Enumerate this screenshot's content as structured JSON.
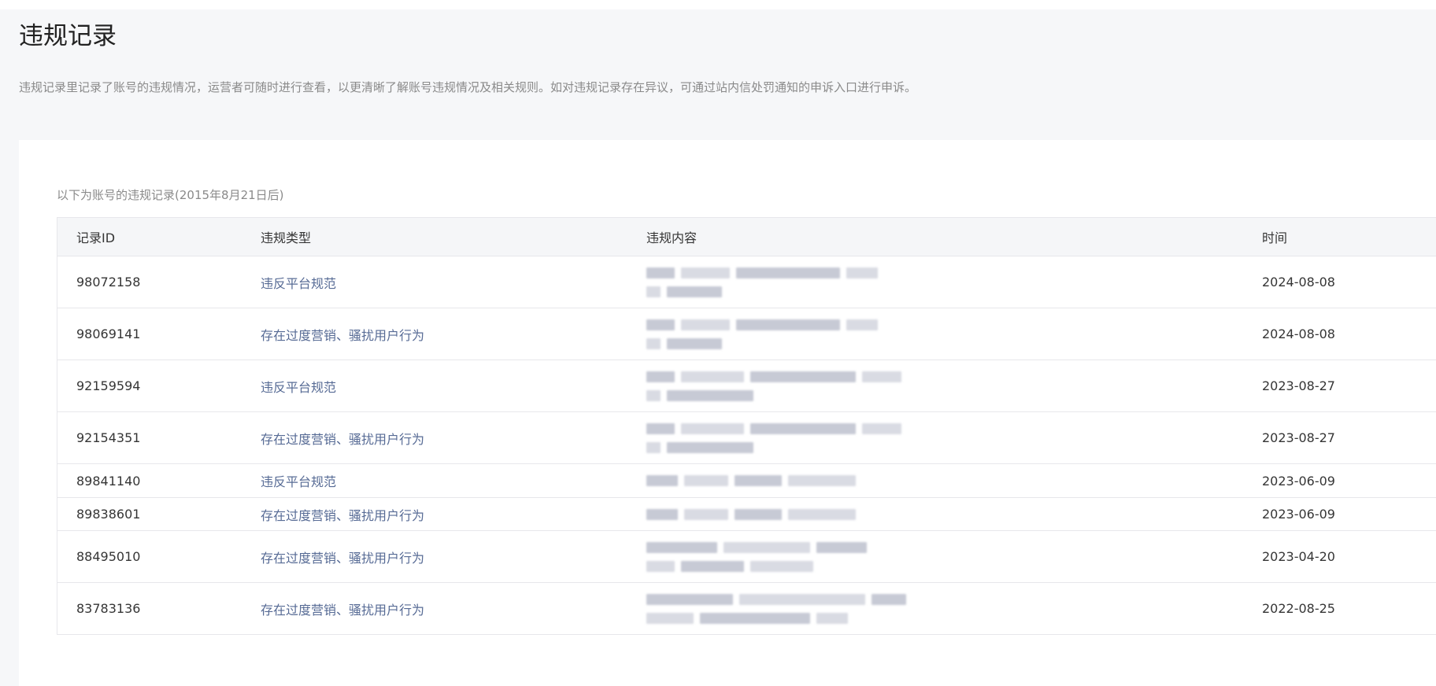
{
  "page": {
    "title": "违规记录",
    "description": "违规记录里记录了账号的违规情况，运营者可随时进行查看，以更清晰了解账号违规情况及相关规则。如对违规记录存在异议，可通过站内信处罚通知的申诉入口进行申诉。"
  },
  "card": {
    "note": "以下为账号的违规记录(2015年8月21日后)"
  },
  "table": {
    "columns": [
      "记录ID",
      "违规类型",
      "违规内容",
      "时间"
    ],
    "rows": [
      {
        "id": "98072158",
        "type": "违反平台规范",
        "date": "2024-08-08"
      },
      {
        "id": "98069141",
        "type": "存在过度营销、骚扰用户行为",
        "date": "2024-08-08"
      },
      {
        "id": "92159594",
        "type": "违反平台规范",
        "date": "2023-08-27"
      },
      {
        "id": "92154351",
        "type": "存在过度营销、骚扰用户行为",
        "date": "2023-08-27"
      },
      {
        "id": "89841140",
        "type": "违反平台规范",
        "date": "2023-06-09"
      },
      {
        "id": "89838601",
        "type": "存在过度营销、骚扰用户行为",
        "date": "2023-06-09"
      },
      {
        "id": "88495010",
        "type": "存在过度营销、骚扰用户行为",
        "date": "2023-04-20"
      },
      {
        "id": "83783136",
        "type": "存在过度营销、骚扰用户行为",
        "date": "2022-08-25"
      }
    ]
  },
  "colors": {
    "link": "#576b95",
    "page_bg": "#f6f7f9",
    "header_bg": "#f5f6f8",
    "border": "#e7e7eb"
  }
}
